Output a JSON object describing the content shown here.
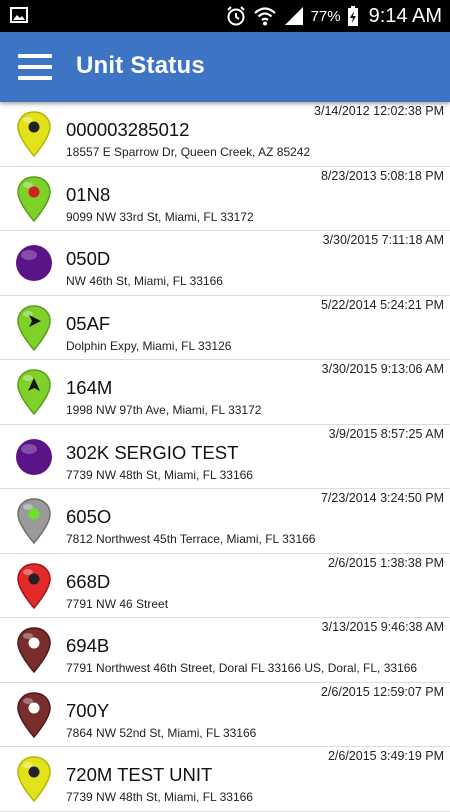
{
  "status_bar": {
    "battery": "77%",
    "time": "9:14 AM"
  },
  "app_bar": {
    "title": "Unit Status",
    "menu_icon": "hamburger-menu-icon"
  },
  "units": [
    {
      "name": "000003285012",
      "address": "18557 E Sparrow Dr, Queen Creek, AZ 85242",
      "timestamp": "3/14/2012 12:02:38 PM",
      "icon": "yellow-pin-black-dot-icon"
    },
    {
      "name": "01N8",
      "address": "9099 NW 33rd St, Miami, FL 33172",
      "timestamp": "8/23/2013 5:08:18 PM",
      "icon": "green-pin-red-dot-icon"
    },
    {
      "name": "050D",
      "address": "NW 46th St, Miami, FL 33166",
      "timestamp": "3/30/2015 7:11:18 AM",
      "icon": "purple-circle-icon"
    },
    {
      "name": "05AF",
      "address": "Dolphin Expy, Miami, FL 33126",
      "timestamp": "5/22/2014 5:24:21 PM",
      "icon": "green-pin-arrow-right-icon"
    },
    {
      "name": "164M",
      "address": "1998 NW 97th Ave, Miami, FL 33172",
      "timestamp": "3/30/2015 9:13:06 AM",
      "icon": "green-pin-arrow-up-icon"
    },
    {
      "name": "302K SERGIO TEST",
      "address": "7739 NW 48th St, Miami, FL 33166",
      "timestamp": "3/9/2015 8:57:25 AM",
      "icon": "purple-circle-icon"
    },
    {
      "name": "605O",
      "address": "7812 Northwest 45th Terrace, Miami, FL 33166",
      "timestamp": "7/23/2014 3:24:50 PM",
      "icon": "gray-pin-green-dot-icon"
    },
    {
      "name": "668D",
      "address": "7791 NW 46 Street",
      "timestamp": "2/6/2015 1:38:38 PM",
      "icon": "red-pin-black-dot-icon"
    },
    {
      "name": "694B",
      "address": "7791 Northwest 46th Street, Doral FL 33166 US, Doral, FL, 33166",
      "timestamp": "3/13/2015 9:46:38 AM",
      "icon": "maroon-pin-white-dot-icon"
    },
    {
      "name": "700Y",
      "address": "7864 NW 52nd St, Miami, FL 33166",
      "timestamp": "2/6/2015 12:59:07 PM",
      "icon": "maroon-pin-white-dot-icon"
    },
    {
      "name": "720M TEST UNIT",
      "address": "7739 NW 48th St, Miami, FL 33166",
      "timestamp": "2/6/2015 3:49:19 PM",
      "icon": "yellow-pin-black-dot-icon"
    }
  ],
  "colors": {
    "app_bar": "#3d74c3",
    "status_bar": "#000000",
    "divider": "#dcdcdc"
  }
}
